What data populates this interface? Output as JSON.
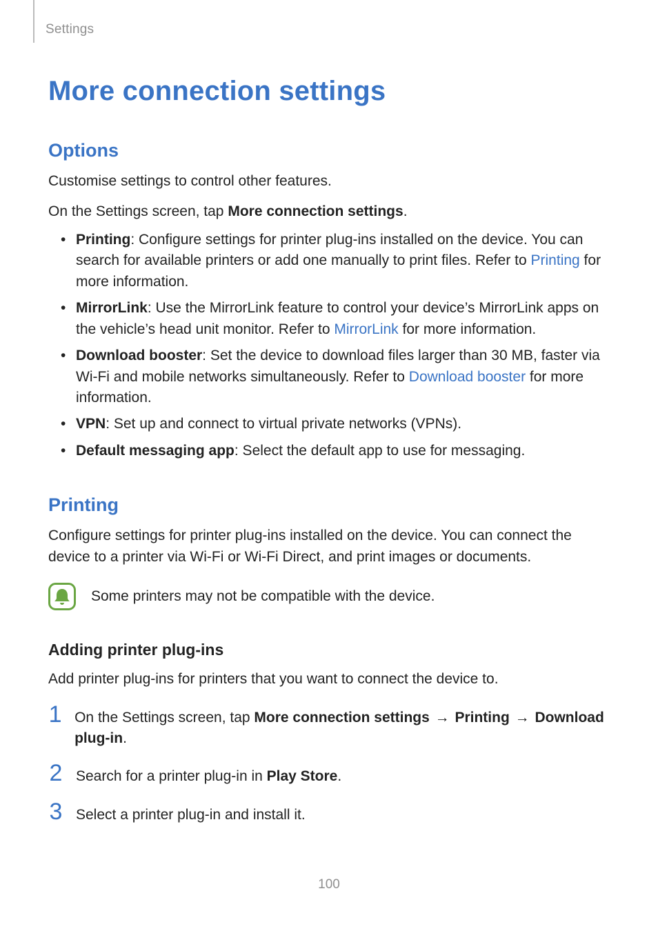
{
  "breadcrumb": "Settings",
  "title": "More connection settings",
  "options": {
    "heading": "Options",
    "intro1": "Customise settings to control other features.",
    "intro2_a": "On the Settings screen, tap ",
    "intro2_b": "More connection settings",
    "intro2_c": ".",
    "items": {
      "printing": {
        "label": "Printing",
        "text_a": ": Configure settings for printer plug-ins installed on the device. You can search for available printers or add one manually to print files. Refer to ",
        "link": "Printing",
        "text_b": " for more information."
      },
      "mirrorlink": {
        "label": "MirrorLink",
        "text_a": ": Use the MirrorLink feature to control your device’s MirrorLink apps on the vehicle’s head unit monitor. Refer to ",
        "link": "MirrorLink",
        "text_b": " for more information."
      },
      "download": {
        "label": "Download booster",
        "text_a": ": Set the device to download files larger than 30 MB, faster via Wi-Fi and mobile networks simultaneously. Refer to ",
        "link": "Download booster",
        "text_b": " for more information."
      },
      "vpn": {
        "label": "VPN",
        "text": ": Set up and connect to virtual private networks (VPNs)."
      },
      "dma": {
        "label": "Default messaging app",
        "text": ": Select the default app to use for messaging."
      }
    }
  },
  "printing": {
    "heading": "Printing",
    "intro": "Configure settings for printer plug-ins installed on the device. You can connect the device to a printer via Wi-Fi or Wi-Fi Direct, and print images or documents.",
    "note": "Some printers may not be compatible with the device.",
    "sub_heading": "Adding printer plug-ins",
    "sub_intro": "Add printer plug-ins for printers that you want to connect the device to.",
    "steps": {
      "s1": {
        "num": "1",
        "a": "On the Settings screen, tap ",
        "b1": "More connection settings",
        "arrow1": " → ",
        "b2": "Printing",
        "arrow2": " → ",
        "b3": "Download plug-in",
        "end": "."
      },
      "s2": {
        "num": "2",
        "a": "Search for a printer plug-in in ",
        "b": "Play Store",
        "end": "."
      },
      "s3": {
        "num": "3",
        "text": "Select a printer plug-in and install it."
      }
    }
  },
  "page_number": "100"
}
